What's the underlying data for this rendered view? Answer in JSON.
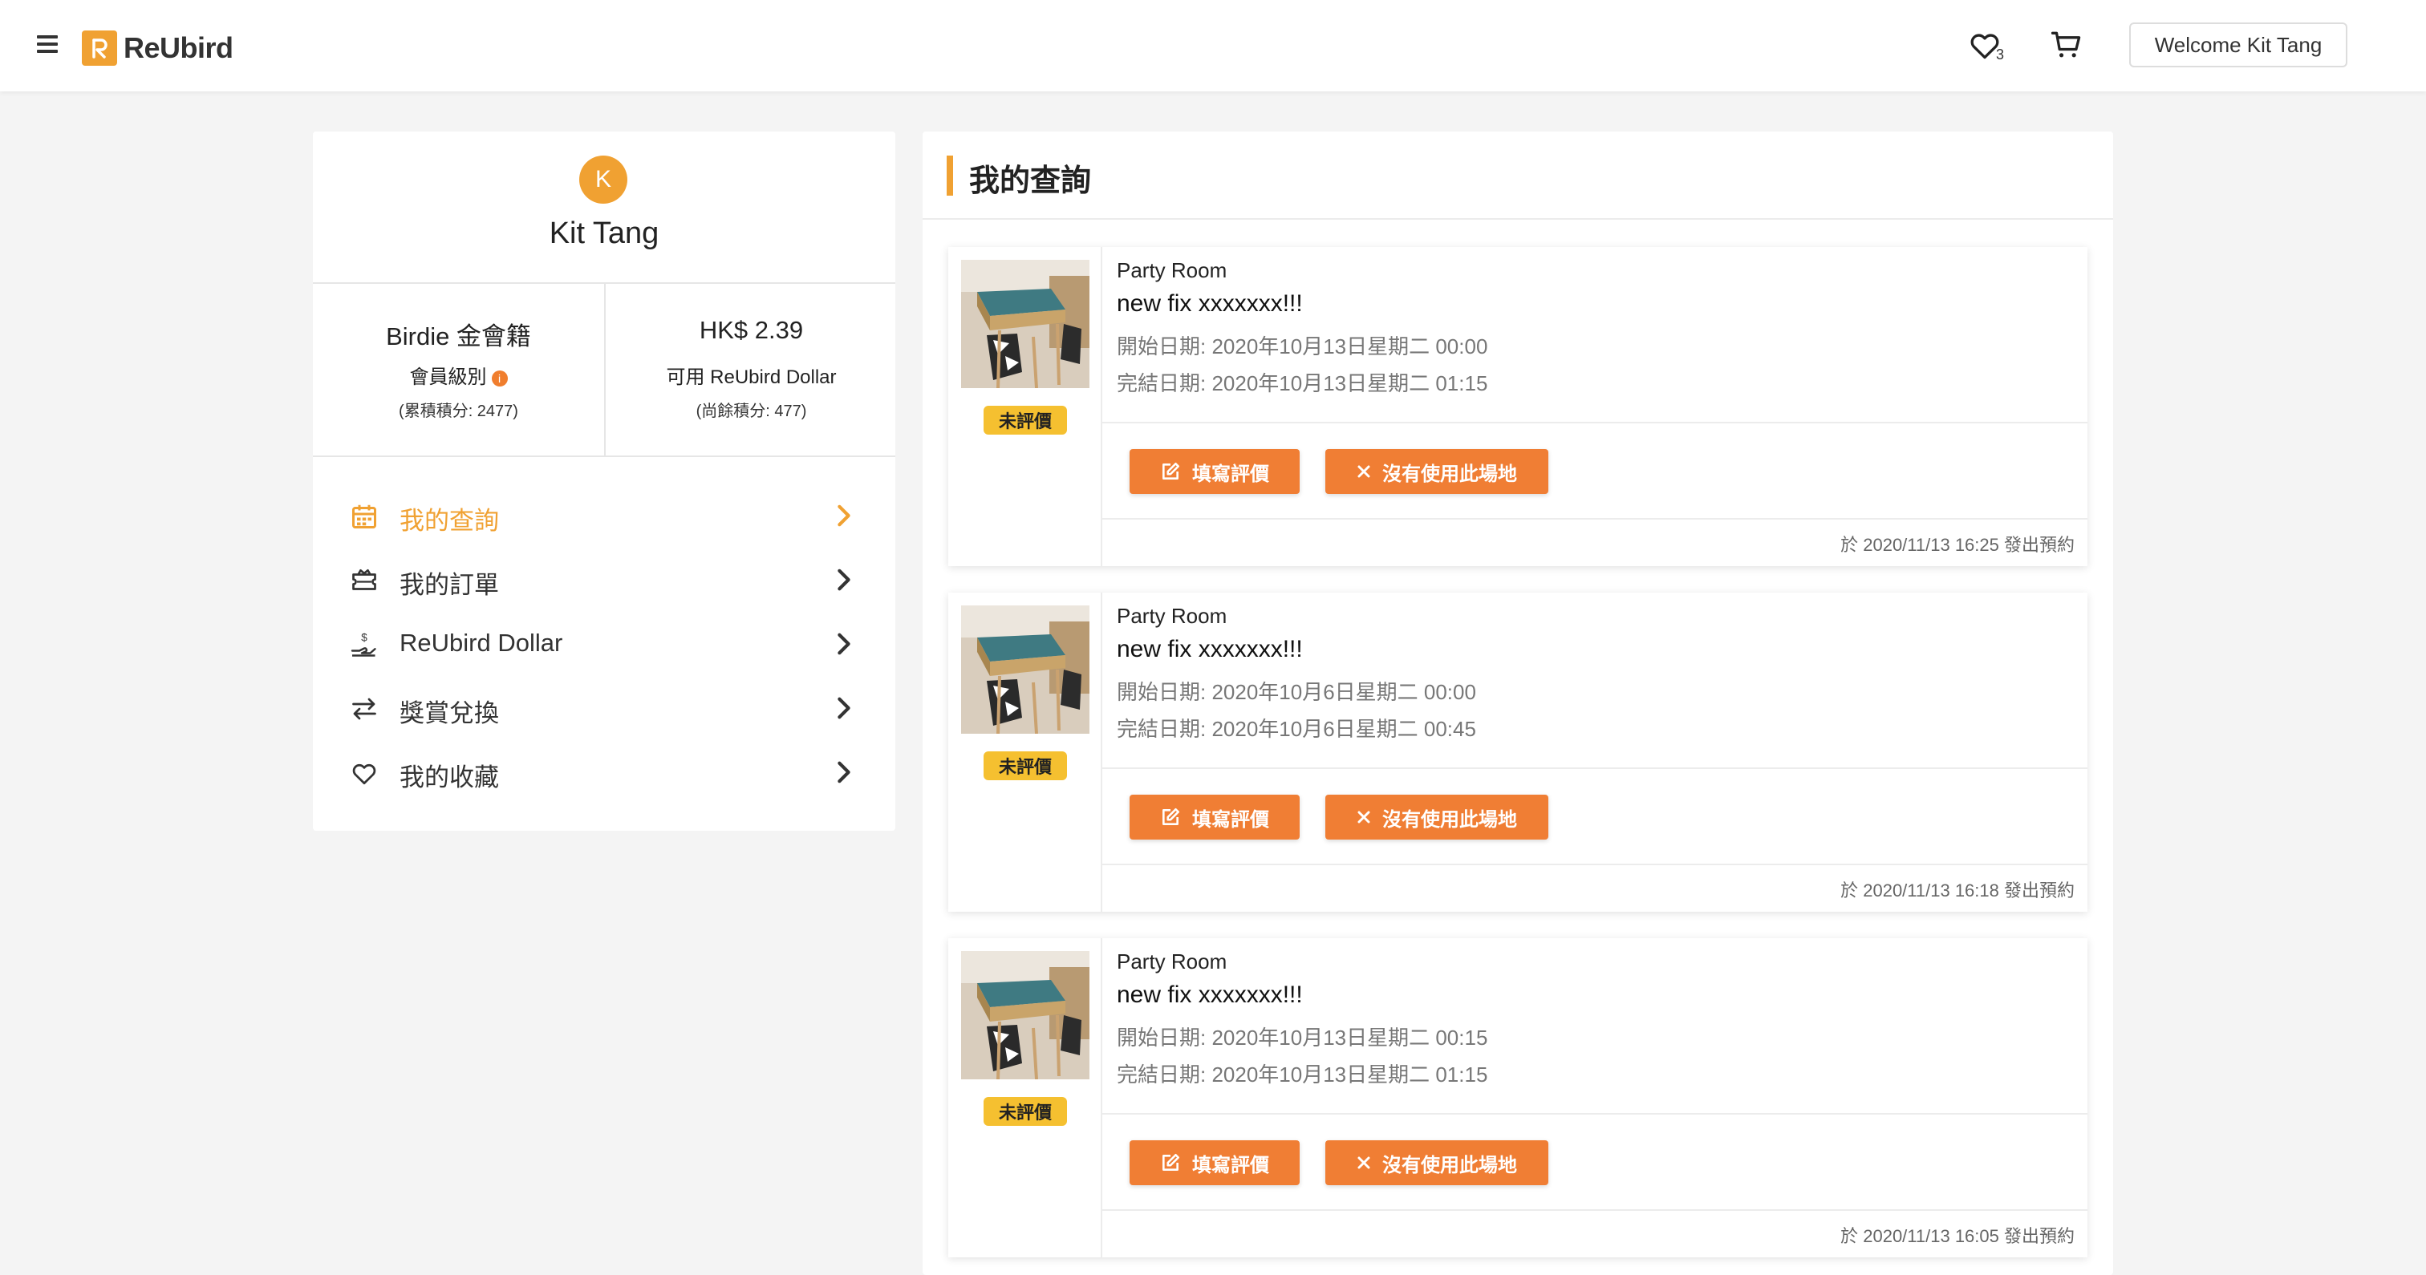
{
  "header": {
    "brand": "ReUbird",
    "favorites_count": "3",
    "welcome": "Welcome Kit Tang",
    "icons": [
      "menu-icon",
      "heart-icon",
      "cart-icon"
    ]
  },
  "profile": {
    "avatar_letter": "K",
    "name": "Kit Tang",
    "membership": {
      "value": "Birdie 金會籍",
      "label": "會員級別",
      "note": "(累積積分: 2477)"
    },
    "balance": {
      "value": "HK$ 2.39",
      "label": "可用 ReUbird Dollar",
      "note": "(尚餘積分: 477)"
    }
  },
  "menu": [
    {
      "label": "我的查詢",
      "icon": "calendar-icon",
      "active": true
    },
    {
      "label": "我的訂單",
      "icon": "ticket-icon",
      "active": false
    },
    {
      "label": "ReUbird Dollar",
      "icon": "coin-hand-icon",
      "active": false
    },
    {
      "label": "獎賞兌換",
      "icon": "exchange-icon",
      "active": false
    },
    {
      "label": "我的收藏",
      "icon": "heart-icon",
      "active": false
    }
  ],
  "main": {
    "title": "我的查詢",
    "bookings": [
      {
        "badge": "未評價",
        "category": "Party Room",
        "name": "new fix xxxxxxx!!!",
        "start": "開始日期: 2020年10月13日星期二 00:00",
        "end": "完結日期: 2020年10月13日星期二 01:15",
        "review_label": "填寫評價",
        "unused_label": "沒有使用此場地",
        "footer": "於 2020/11/13 16:25 發出預約"
      },
      {
        "badge": "未評價",
        "category": "Party Room",
        "name": "new fix xxxxxxx!!!",
        "start": "開始日期: 2020年10月6日星期二 00:00",
        "end": "完結日期: 2020年10月6日星期二 00:45",
        "review_label": "填寫評價",
        "unused_label": "沒有使用此場地",
        "footer": "於 2020/11/13 16:18 發出預約"
      },
      {
        "badge": "未評價",
        "category": "Party Room",
        "name": "new fix xxxxxxx!!!",
        "start": "開始日期: 2020年10月13日星期二 00:15",
        "end": "完結日期: 2020年10月13日星期二 01:15",
        "review_label": "填寫評價",
        "unused_label": "沒有使用此場地",
        "footer": "於 2020/11/13 16:05 發出預約"
      }
    ]
  },
  "colors": {
    "accent": "#f0a132",
    "button": "#f07e34",
    "badge": "#f5c030"
  }
}
